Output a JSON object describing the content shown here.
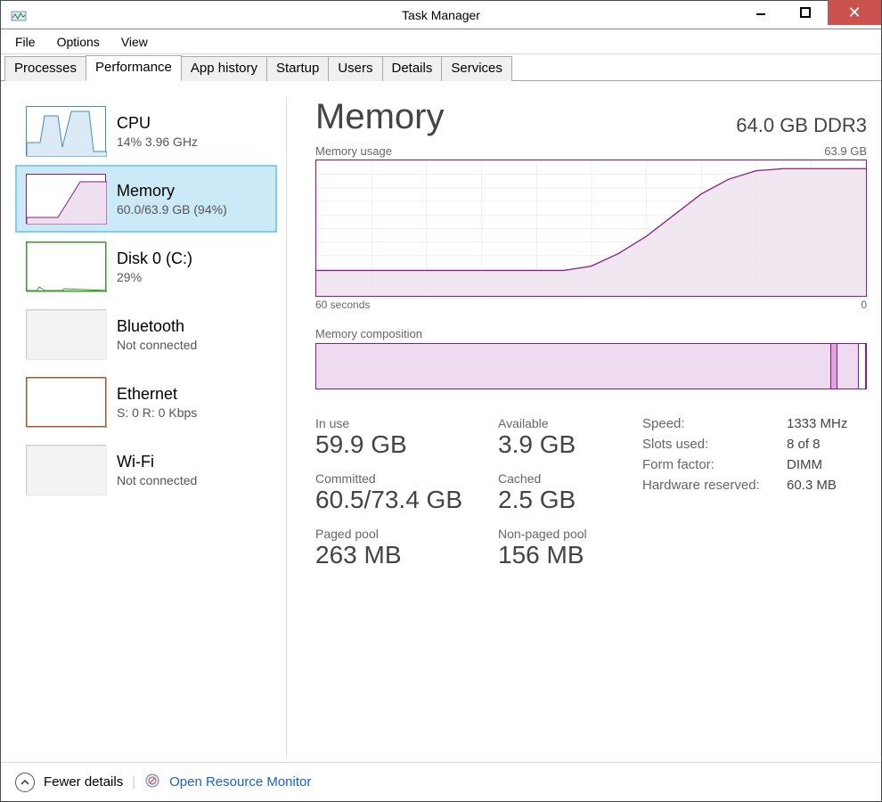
{
  "window": {
    "title": "Task Manager"
  },
  "menu": {
    "file": "File",
    "options": "Options",
    "view": "View"
  },
  "tabs": [
    "Processes",
    "Performance",
    "App history",
    "Startup",
    "Users",
    "Details",
    "Services"
  ],
  "active_tab_index": 1,
  "sidebar": {
    "items": [
      {
        "title": "CPU",
        "sub": "14%  3.96 GHz",
        "color": "#3f8fbf",
        "kind": "cpu"
      },
      {
        "title": "Memory",
        "sub": "60.0/63.9 GB (94%)",
        "color": "#8b1a89",
        "kind": "memory",
        "selected": true
      },
      {
        "title": "Disk 0 (C:)",
        "sub": "29%",
        "color": "#3a9a2c",
        "kind": "disk"
      },
      {
        "title": "Bluetooth",
        "sub": "Not connected",
        "color": "#cccccc",
        "kind": "bt"
      },
      {
        "title": "Ethernet",
        "sub": "S: 0  R: 0 Kbps",
        "color": "#a05a2c",
        "kind": "eth"
      },
      {
        "title": "Wi-Fi",
        "sub": "Not connected",
        "color": "#cccccc",
        "kind": "wifi"
      }
    ]
  },
  "panel": {
    "title": "Memory",
    "title_right": "64.0 GB DDR3",
    "chart_usage_label_left": "Memory usage",
    "chart_usage_label_right": "63.9 GB",
    "axis_left": "60 seconds",
    "axis_right": "0",
    "comp_label": "Memory composition",
    "stats": {
      "in_use": {
        "label": "In use",
        "value": "59.9 GB"
      },
      "available": {
        "label": "Available",
        "value": "3.9 GB"
      },
      "committed": {
        "label": "Committed",
        "value": "60.5/73.4 GB"
      },
      "cached": {
        "label": "Cached",
        "value": "2.5 GB"
      },
      "paged": {
        "label": "Paged pool",
        "value": "263 MB"
      },
      "nonpaged": {
        "label": "Non-paged pool",
        "value": "156 MB"
      }
    },
    "hw": {
      "speed": {
        "k": "Speed:",
        "v": "1333 MHz"
      },
      "slots": {
        "k": "Slots used:",
        "v": "8 of 8"
      },
      "form": {
        "k": "Form factor:",
        "v": "DIMM"
      },
      "reserved": {
        "k": "Hardware reserved:",
        "v": "60.3 MB"
      }
    }
  },
  "footer": {
    "fewer": "Fewer details",
    "orm": "Open Resource Monitor"
  },
  "chart_data": {
    "type": "area",
    "title": "Memory usage",
    "xlabel": "seconds ago",
    "ylabel": "GB",
    "ylim": [
      0,
      63.9
    ],
    "x": [
      60,
      57,
      54,
      51,
      48,
      45,
      42,
      39,
      36,
      33,
      30,
      27,
      24,
      21,
      18,
      15,
      12,
      9,
      6,
      3,
      0
    ],
    "values": [
      12,
      12,
      12,
      12,
      12,
      12,
      12,
      12,
      12,
      12,
      14,
      20,
      28,
      38,
      48,
      55,
      59,
      60,
      60,
      60,
      60
    ]
  },
  "composition": {
    "total_gb": 63.9,
    "segments": [
      {
        "name": "in_use",
        "gb": 59.9,
        "shade": "#efdbef"
      },
      {
        "name": "modified",
        "gb": 0.7,
        "shade": "#d9a7d8"
      },
      {
        "name": "standby",
        "gb": 2.5,
        "shade": "#efdbef"
      },
      {
        "name": "free",
        "gb": 0.8,
        "shade": "#ffffff"
      }
    ]
  }
}
